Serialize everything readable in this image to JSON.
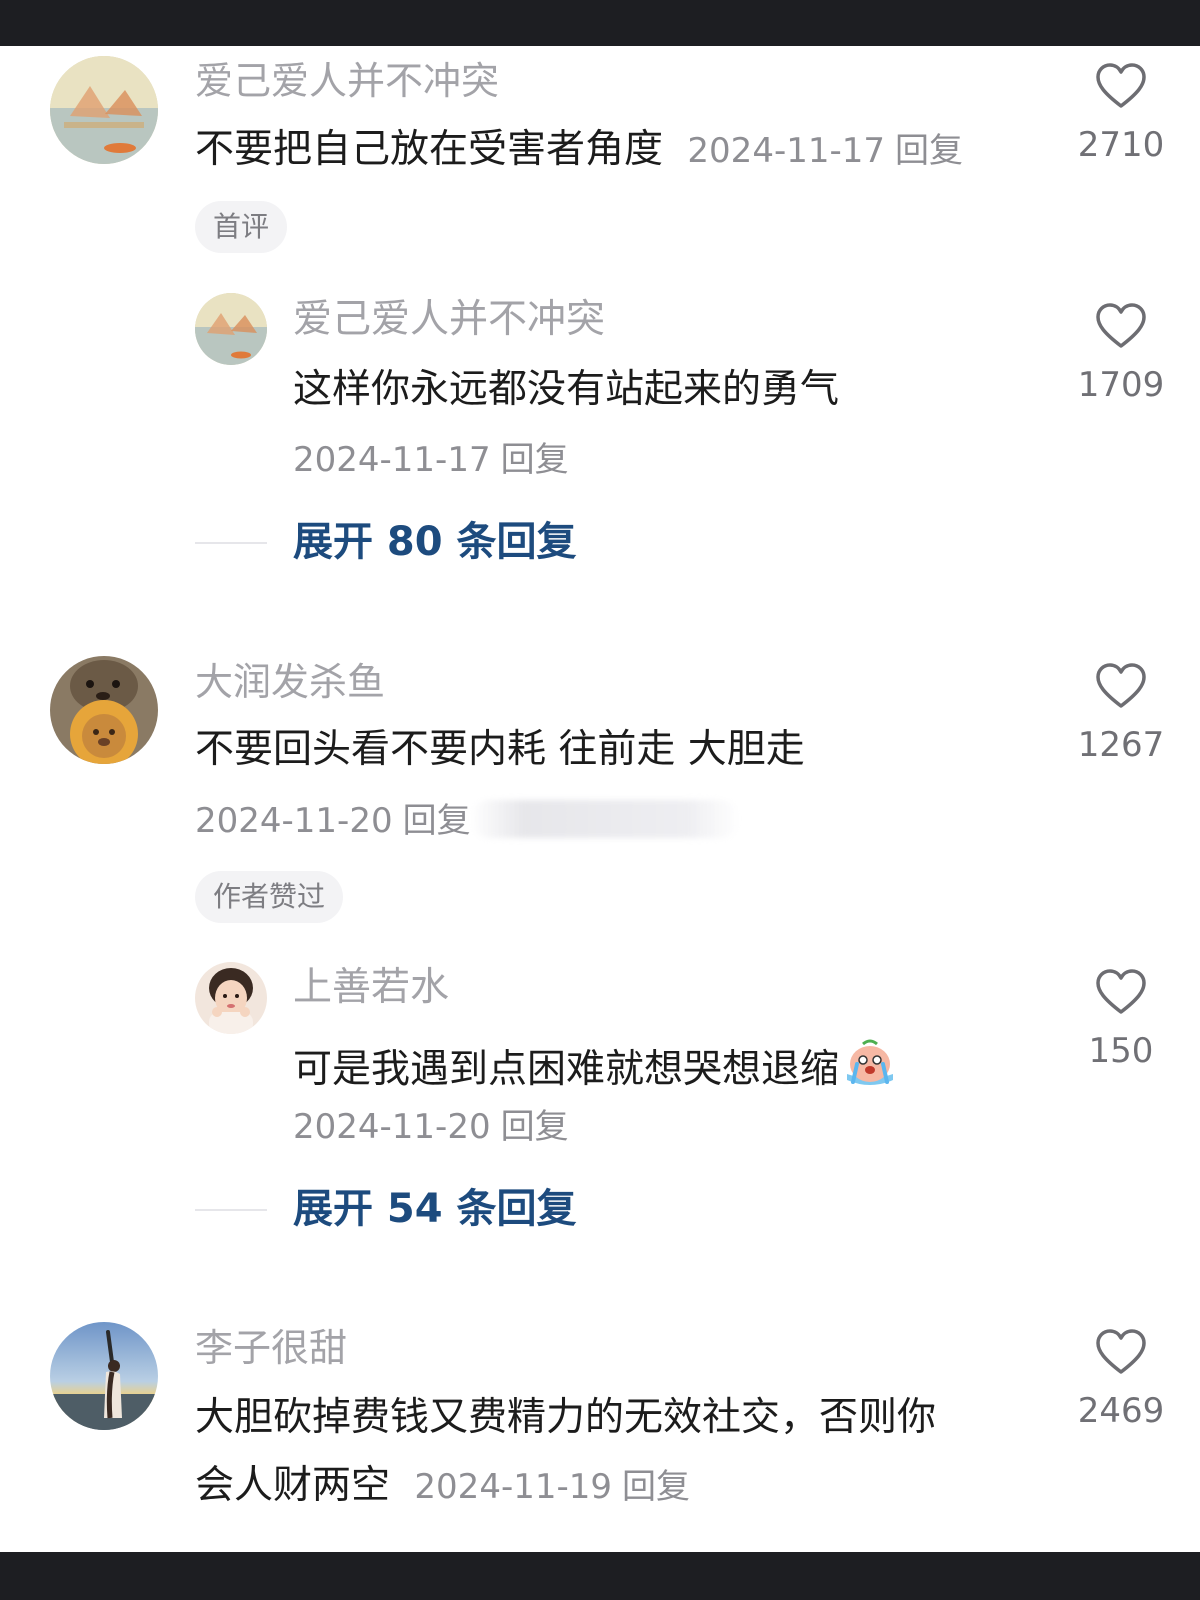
{
  "comments": [
    {
      "username": "爱己爱人并不冲突",
      "text": "不要把自己放在受害者角度",
      "date": "2024-11-17",
      "reply_label": "回复",
      "likes": "2710",
      "badge": "首评",
      "sub_reply": {
        "username": "爱己爱人并不冲突",
        "text": "这样你永远都没有站起来的勇气",
        "date": "2024-11-17",
        "reply_label": "回复",
        "likes": "1709"
      },
      "expand_label": "展开 80 条回复"
    },
    {
      "username": "大润发杀鱼",
      "text": "不要回头看不要内耗 往前走 大胆走",
      "date": "2024-11-20",
      "reply_label": "回复",
      "likes": "1267",
      "badge": "作者赞过",
      "sub_reply": {
        "username": "上善若水",
        "text": "可是我遇到点困难就想哭想退缩",
        "emoji": "crying-face-icon",
        "date": "2024-11-20",
        "reply_label": "回复",
        "likes": "150"
      },
      "expand_label": "展开 54 条回复"
    },
    {
      "username": "李子很甜",
      "text_line1": "大胆砍掉费钱又费精力的无效社交，否则你",
      "text_line2": "会人财两空",
      "date": "2024-11-19",
      "reply_label": "回复",
      "likes": "2469"
    }
  ],
  "colors": {
    "link": "#1d4b7e",
    "username": "#a3a3a8",
    "meta": "#8e8e93",
    "frame": "#1d1e22"
  }
}
